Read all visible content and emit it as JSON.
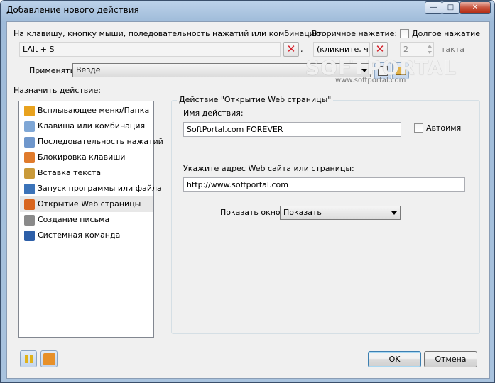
{
  "window": {
    "title": "Добавление нового действия",
    "min_glyph": "—",
    "max_glyph": "□",
    "close_glyph": "✕"
  },
  "hotkey": {
    "label": "На клавишу, кнопку мыши, поледовательность нажатий или комбинацию:",
    "value": "LAlt + S",
    "comma": ","
  },
  "secondary": {
    "label": "Вторичное нажатие:",
    "value": "(кликните, что"
  },
  "long_press": {
    "label": "Долгое нажатие",
    "value": "2",
    "unit": "такта",
    "checked": false
  },
  "apply": {
    "label": "Применять",
    "value": "Везде"
  },
  "assign_label": "Назначить действие:",
  "actions": [
    {
      "label": "Всплывающее меню/Папка",
      "icon": "folder-menu-icon",
      "color": "#e8a21e"
    },
    {
      "label": "Клавиша или комбинация",
      "icon": "keyboard-key-icon",
      "color": "#7fa7d6"
    },
    {
      "label": "Последовательность нажатий",
      "icon": "key-sequence-icon",
      "color": "#6f97cc"
    },
    {
      "label": "Блокировка клавиши",
      "icon": "key-lock-icon",
      "color": "#e07b2c"
    },
    {
      "label": "Вставка текста",
      "icon": "paste-text-icon",
      "color": "#c99a3a"
    },
    {
      "label": "Запуск программы или файла",
      "icon": "run-program-icon",
      "color": "#3b73b9"
    },
    {
      "label": "Открытие Web страницы",
      "icon": "web-globe-icon",
      "color": "#d8651e"
    },
    {
      "label": "Создание письма",
      "icon": "mail-icon",
      "color": "#8a8a8a"
    },
    {
      "label": "Системная команда",
      "icon": "system-command-icon",
      "color": "#2d5fa8"
    }
  ],
  "selected_action_index": 6,
  "group": {
    "title": "Действие \"Открытие Web страницы\"",
    "name_label": "Имя действия:",
    "name_value": "SoftPortal.com FOREVER",
    "autoname_label": "Автоимя",
    "url_label": "Укажите адрес Web сайта или страницы:",
    "url_value": "http://www.softportal.com",
    "show_label": "Показать окно",
    "show_value": "Показать"
  },
  "buttons": {
    "ok": "OK",
    "cancel": "Отмена"
  },
  "watermark": {
    "main": "SOFTPORTAL",
    "sub": "www.softportal.com"
  }
}
